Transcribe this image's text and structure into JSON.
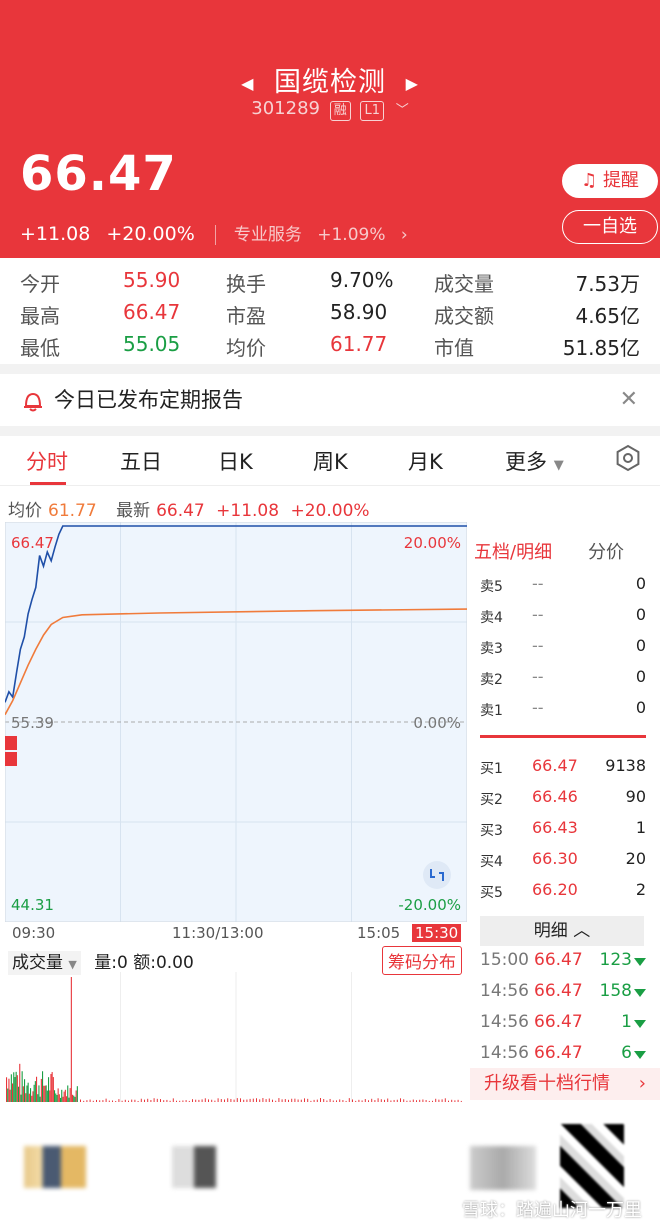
{
  "header": {
    "stock_name": "国缆检测",
    "stock_code": "301289",
    "tag_margin": "融",
    "tag_level": "L1",
    "price": "66.47",
    "change": "+11.08",
    "change_pct": "+20.00%",
    "service_label": "专业服务",
    "service_pct": "+1.09%",
    "remind_button": "提醒",
    "fav_button": "一自选"
  },
  "stats": [
    [
      {
        "label": "今开",
        "value": "55.90",
        "tone": "red"
      },
      {
        "label": "换手",
        "value": "9.70%"
      },
      {
        "label": "成交量",
        "value": "7.53万"
      }
    ],
    [
      {
        "label": "最高",
        "value": "66.47",
        "tone": "red"
      },
      {
        "label": "市盈",
        "value": "58.90"
      },
      {
        "label": "成交额",
        "value": "4.65亿"
      }
    ],
    [
      {
        "label": "最低",
        "value": "55.05",
        "tone": "green"
      },
      {
        "label": "均价",
        "value": "61.77",
        "tone": "red"
      },
      {
        "label": "市值",
        "value": "51.85亿"
      }
    ]
  ],
  "notice": {
    "text": "今日已发布定期报告"
  },
  "tabs": [
    "分时",
    "五日",
    "日K",
    "周K",
    "月K",
    "更多"
  ],
  "info_line": {
    "avg_label": "均价",
    "avg_value": "61.77",
    "latest_label": "最新",
    "latest_value": "66.47",
    "change": "+11.08",
    "change_pct": "+20.00%"
  },
  "chart_labels": {
    "top_price": "66.47",
    "top_pct": "20.00%",
    "mid_price": "55.39",
    "mid_pct": "0.00%",
    "bottom_price": "44.31",
    "bottom_pct": "-20.00%",
    "time_start": "09:30",
    "time_mid": "11:30/13:00",
    "time_end": "15:05",
    "time_close": "15:30"
  },
  "chart_data": {
    "type": "line",
    "ylim": [
      44.31,
      66.47
    ],
    "reference": 55.39,
    "series": [
      {
        "name": "最新",
        "color": "#1f4fa8",
        "x": [
          0,
          2,
          4,
          6,
          8,
          10,
          12,
          14,
          16,
          18,
          20,
          22,
          24,
          26,
          28,
          30,
          240
        ],
        "values": [
          56.5,
          57.1,
          56.8,
          58.2,
          59.5,
          60.2,
          61.5,
          62.3,
          63.0,
          64.8,
          64.2,
          65.0,
          64.5,
          65.3,
          66.0,
          66.47,
          66.47
        ]
      },
      {
        "name": "均价",
        "color": "#f07b3b",
        "x": [
          0,
          4,
          8,
          12,
          16,
          20,
          24,
          30,
          40,
          80,
          160,
          240
        ],
        "values": [
          55.8,
          56.6,
          57.6,
          58.6,
          59.5,
          60.3,
          60.9,
          61.3,
          61.45,
          61.55,
          61.68,
          61.77
        ]
      }
    ]
  },
  "order_book": {
    "tab_a": "五档/明细",
    "tab_b": "分价",
    "sell": [
      {
        "k": "卖5",
        "p": "--",
        "v": "0"
      },
      {
        "k": "卖4",
        "p": "--",
        "v": "0"
      },
      {
        "k": "卖3",
        "p": "--",
        "v": "0"
      },
      {
        "k": "卖2",
        "p": "--",
        "v": "0"
      },
      {
        "k": "卖1",
        "p": "--",
        "v": "0"
      }
    ],
    "buy": [
      {
        "k": "买1",
        "p": "66.47",
        "v": "9138"
      },
      {
        "k": "买2",
        "p": "66.46",
        "v": "90"
      },
      {
        "k": "买3",
        "p": "66.43",
        "v": "1"
      },
      {
        "k": "买4",
        "p": "66.30",
        "v": "20"
      },
      {
        "k": "买5",
        "p": "66.20",
        "v": "2"
      }
    ],
    "detail_label": "明细",
    "details": [
      {
        "t": "15:00",
        "p": "66.47",
        "v": "123"
      },
      {
        "t": "14:56",
        "p": "66.47",
        "v": "158"
      },
      {
        "t": "14:56",
        "p": "66.47",
        "v": "1"
      },
      {
        "t": "14:56",
        "p": "66.47",
        "v": "6"
      }
    ],
    "upgrade_label": "升级看十档行情"
  },
  "volume": {
    "select_label": "成交量",
    "vol_text": "量:0",
    "amount_text": "额:0.00",
    "chip_button": "筹码分布"
  },
  "watermark": "雪球：踏遍山河一万里"
}
